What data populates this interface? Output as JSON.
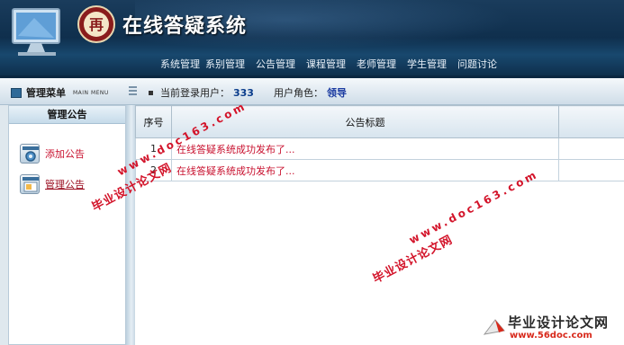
{
  "header": {
    "title": "在线答疑系统",
    "logo_text": "再",
    "nav": [
      "系统管理",
      "系别管理",
      "公告管理",
      "课程管理",
      "老师管理",
      "学生管理",
      "问题讨论"
    ]
  },
  "status": {
    "menu_label": "管理菜单",
    "menu_label_en": "MAIN MENU",
    "current_user_label": "当前登录用户：",
    "current_user_value": "333",
    "role_label": "用户角色：",
    "role_value": "领导"
  },
  "sidebar": {
    "title": "管理公告",
    "items": [
      {
        "label": "添加公告",
        "icon": "gear-icon"
      },
      {
        "label": "管理公告",
        "icon": "window-icon"
      }
    ]
  },
  "table": {
    "headers": [
      "序号",
      "公告标题"
    ],
    "rows": [
      {
        "idx": "1",
        "title": "在线答疑系统成功发布了..."
      },
      {
        "idx": "2",
        "title": "在线答疑系统成功发布了..."
      }
    ]
  },
  "watermarks": {
    "site_cn": "毕业设计论文网",
    "site_url": "www.doc163.com",
    "corner_cn": "毕业设计论文网",
    "corner_url": "www.56doc.com"
  },
  "colors": {
    "header_dark": "#0f2f4d",
    "link_red": "#c8102e",
    "role_blue": "#1a3aa0"
  }
}
